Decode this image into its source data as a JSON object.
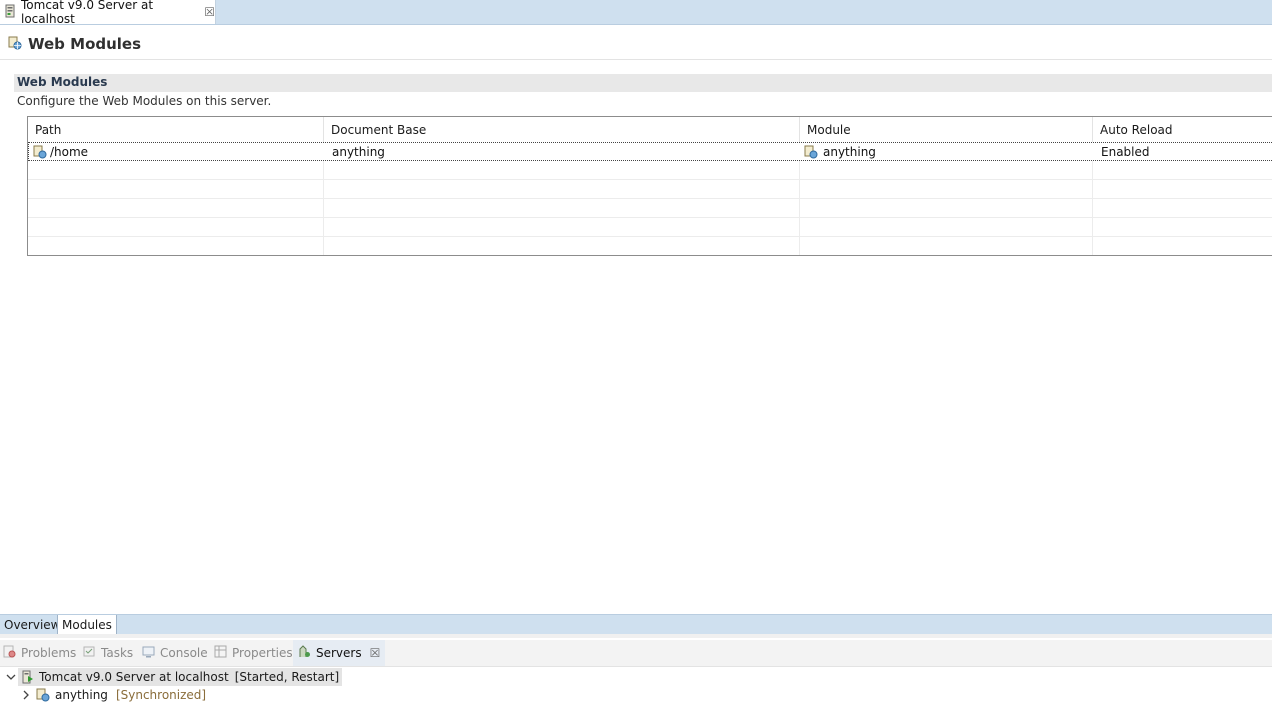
{
  "editor": {
    "tab_label": "Tomcat v9.0 Server at localhost",
    "close_glyph": "☒",
    "tab_icon": "server-icon"
  },
  "page": {
    "title": "Web Modules",
    "title_icon": "web-module-icon"
  },
  "section": {
    "title": "Web Modules",
    "description": "Configure the Web Modules on this server."
  },
  "table": {
    "columns": [
      "Path",
      "Document Base",
      "Module",
      "Auto Reload"
    ],
    "rows": [
      {
        "path": "/home",
        "document_base": "anything",
        "module": "anything",
        "auto_reload": "Enabled"
      }
    ]
  },
  "page_tabs": [
    "Overview",
    "Modules"
  ],
  "active_page_tab": "Modules",
  "views": {
    "tabs": [
      {
        "label": "Problems",
        "icon": "problems-icon"
      },
      {
        "label": "Tasks",
        "icon": "tasks-icon"
      },
      {
        "label": "Console",
        "icon": "console-icon"
      },
      {
        "label": "Properties",
        "icon": "properties-icon"
      },
      {
        "label": "Servers",
        "icon": "servers-icon"
      }
    ],
    "active": "Servers",
    "close_glyph": "☒"
  },
  "servers_tree": {
    "server": {
      "label": "Tomcat v9.0 Server at localhost",
      "state": "[Started, Restart]",
      "expanded": true
    },
    "module": {
      "label": "anything",
      "state": "[Synchronized]"
    }
  },
  "colors": {
    "tab_bar": "#cfe0ef",
    "status_text": "#8a6d3b",
    "section_header": "#e8e8e8"
  }
}
